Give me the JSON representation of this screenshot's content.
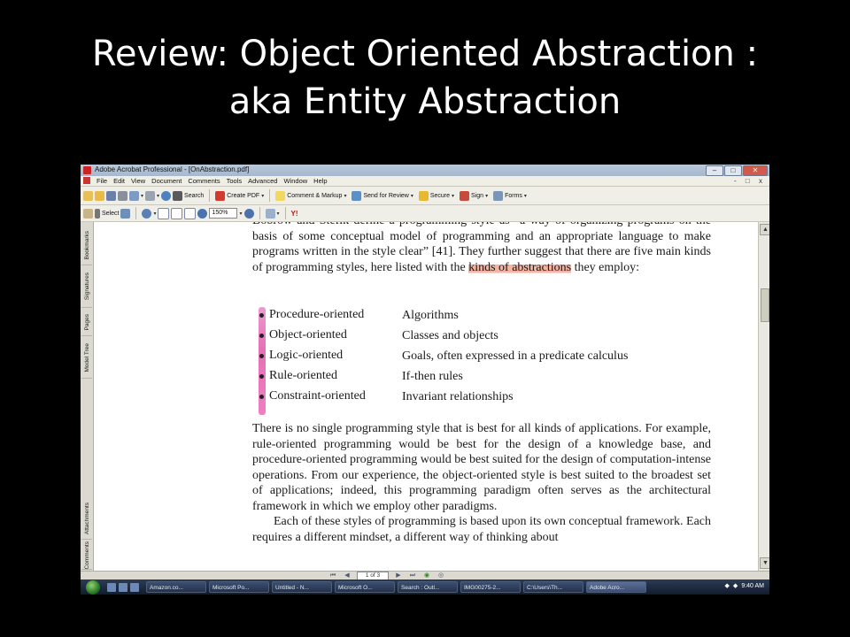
{
  "slide": {
    "title_line1": "Review: Object Oriented Abstraction :",
    "title_line2": "aka Entity Abstraction"
  },
  "window": {
    "title": "Adobe Acrobat Professional - [OnAbstraction.pdf]",
    "controls": [
      "–",
      "□",
      "✕"
    ]
  },
  "menubar": {
    "items": [
      "File",
      "Edit",
      "View",
      "Document",
      "Comments",
      "Tools",
      "Advanced",
      "Window",
      "Help"
    ],
    "right_controls": "- □ x"
  },
  "toolbar1": {
    "search": "Search",
    "create_pdf": "Create PDF",
    "comment_markup": "Comment & Markup",
    "send_review": "Send for Review",
    "secure": "Secure",
    "sign": "Sign",
    "forms": "Forms"
  },
  "toolbar2": {
    "select": "Select",
    "zoom": "150%"
  },
  "nav_tabs": [
    "Bookmarks",
    "Signatures",
    "Pages",
    "Model Tree",
    "Attachments",
    "Comments"
  ],
  "document": {
    "para1": {
      "pre": "Bobrow and Stefik define a programming style as “a way of organizing programs on the basis of some conceptual model of programming and an appropriate language to make programs written in the style clear” [41]. They further suggest that there are five main kinds of programming styles, here listed with the ",
      "highlight": "kinds of abstractions",
      "post": " they employ:"
    },
    "bullets": [
      {
        "kind": "Procedure-oriented",
        "abstraction": "Algorithms"
      },
      {
        "kind": "Object-oriented",
        "abstraction": "Classes and objects"
      },
      {
        "kind": "Logic-oriented",
        "abstraction": "Goals, often expressed in a predicate calculus"
      },
      {
        "kind": "Rule-oriented",
        "abstraction": "If-then rules"
      },
      {
        "kind": "Constraint-oriented",
        "abstraction": "Invariant relationships"
      }
    ],
    "para2": "There is no single programming style that is best for all kinds of applications. For example, rule-oriented programming would be best for the design of a knowledge base, and procedure-oriented programming would be best suited for the design of computation-intense operations. From our experience, the object-oriented style is best suited to the broadest set of applications; indeed, this programming paradigm often serves as the architectural framework in which we employ other paradigms.",
    "para3": "Each of these styles of programming is based upon its own conceptual framework. Each requires a different mindset, a different way of thinking about"
  },
  "statusbar": {
    "page": "1 of 3"
  },
  "taskbar": {
    "tasks": [
      "Amazon.co...",
      "Microsoft Po...",
      "Untitled - N...",
      "Microsoft O...",
      "Search : Outl...",
      "IMG00275-2...",
      "C:\\Users\\Th...",
      "Adobe Acro..."
    ],
    "clock": "9:40 AM"
  },
  "colors": {
    "highlight": "#f7b3a2",
    "marker": "#e356a8",
    "taskbar": "#1c2a40"
  }
}
